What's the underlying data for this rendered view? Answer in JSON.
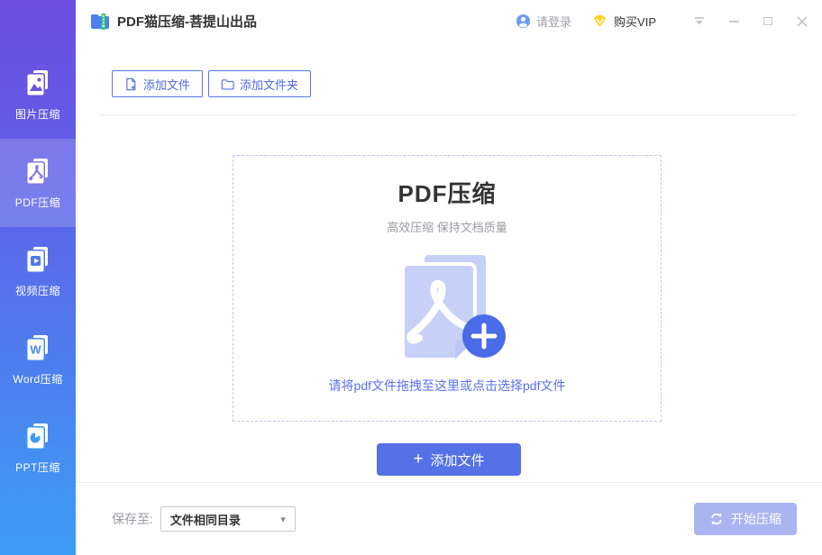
{
  "titlebar": {
    "app_title": "PDF猫压缩-菩提山出品",
    "login_label": "请登录",
    "vip_label": "购买VIP"
  },
  "sidebar": {
    "items": [
      {
        "label": "图片压缩",
        "icon": "image-compress-icon",
        "active": false
      },
      {
        "label": "PDF压缩",
        "icon": "pdf-compress-icon",
        "active": true
      },
      {
        "label": "视频压缩",
        "icon": "video-compress-icon",
        "active": false
      },
      {
        "label": "Word压缩",
        "icon": "word-compress-icon",
        "active": false
      },
      {
        "label": "PPT压缩",
        "icon": "ppt-compress-icon",
        "active": false
      }
    ]
  },
  "toolbar": {
    "add_file_label": "添加文件",
    "add_folder_label": "添加文件夹"
  },
  "dropzone": {
    "title": "PDF压缩",
    "subtitle": "高效压缩 保持文档质量",
    "hint": "请将pdf文件拖拽至这里或点击选择pdf文件"
  },
  "actions": {
    "add_files_label": "添加文件",
    "start_label": "开始压缩"
  },
  "footer": {
    "save_to_label": "保存至:",
    "save_location_value": "文件相同目录"
  },
  "icons": {
    "plus": "+",
    "dropdown_arrow": "▾"
  },
  "colors": {
    "accent": "#5571E6",
    "sidebar_gradient_top": "#6C4DE2",
    "sidebar_gradient_bottom": "#3C9DF6",
    "disabled_button": "#A9B4F1",
    "hint_text": "#5C6FF0",
    "vip_yellow": "#FFD21E"
  }
}
